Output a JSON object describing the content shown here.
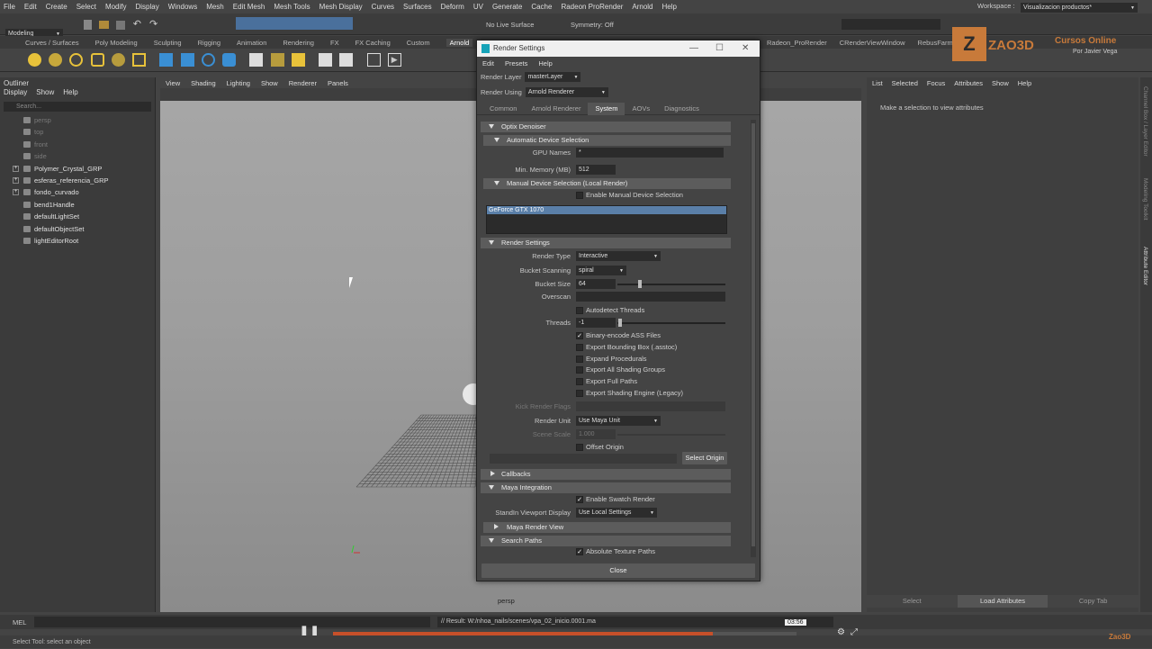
{
  "menubar": [
    "File",
    "Edit",
    "Create",
    "Select",
    "Modify",
    "Display",
    "Windows",
    "Mesh",
    "Edit Mesh",
    "Mesh Tools",
    "Mesh Display",
    "Curves",
    "Surfaces",
    "Deform",
    "UV",
    "Generate",
    "Cache",
    "Radeon ProRender",
    "Arnold",
    "Help"
  ],
  "workspace": {
    "label": "Workspace :",
    "value": "Visualizacion productos*"
  },
  "statusline": {
    "mode": "Modeling",
    "live": "No Live Surface",
    "symmetry": "Symmetry: Off"
  },
  "shelf_tabs": [
    "Curves / Surfaces",
    "Poly Modeling",
    "Sculpting",
    "Rigging",
    "Animation",
    "Rendering",
    "FX",
    "FX Caching",
    "Custom",
    "Arnold"
  ],
  "shelf_tabs_right": [
    "Radeon_ProRender",
    "CRenderViewWindow",
    "RebusFarm"
  ],
  "brand": {
    "logo": "ZAO3D",
    "title": "Cursos Online",
    "subtitle": "Por Javier Vega"
  },
  "outliner": {
    "title": "Outliner",
    "menu": [
      "Display",
      "Show",
      "Help"
    ],
    "search": "Search...",
    "items": [
      {
        "label": "persp",
        "dim": true,
        "type": "cam"
      },
      {
        "label": "top",
        "dim": true,
        "type": "cam"
      },
      {
        "label": "front",
        "dim": true,
        "type": "cam"
      },
      {
        "label": "side",
        "dim": true,
        "type": "cam"
      },
      {
        "label": "Polymer_Crystal_GRP",
        "dim": false,
        "type": "grp"
      },
      {
        "label": "esferas_referencia_GRP",
        "dim": false,
        "type": "grp"
      },
      {
        "label": "fondo_curvado",
        "dim": false,
        "type": "grp"
      },
      {
        "label": "bend1Handle",
        "dim": false,
        "type": "obj"
      },
      {
        "label": "defaultLightSet",
        "dim": false,
        "type": "obj"
      },
      {
        "label": "defaultObjectSet",
        "dim": false,
        "type": "obj"
      },
      {
        "label": "lightEditorRoot",
        "dim": false,
        "type": "obj"
      }
    ]
  },
  "viewport": {
    "menu": [
      "View",
      "Shading",
      "Lighting",
      "Show",
      "Renderer",
      "Panels"
    ],
    "camera": "persp"
  },
  "attribute_editor": {
    "menu": [
      "List",
      "Selected",
      "Focus",
      "Attributes",
      "Show",
      "Help"
    ],
    "message": "Make a selection to view attributes",
    "buttons": [
      "Select",
      "Load Attributes",
      "Copy Tab"
    ],
    "side_tabs": [
      "Channel Box / Layer Editor",
      "Modeling Toolkit",
      "Attribute Editor"
    ]
  },
  "dialog": {
    "title": "Render Settings",
    "menu": [
      "Edit",
      "Presets",
      "Help"
    ],
    "render_layer_label": "Render Layer",
    "render_layer": "masterLayer",
    "render_using_label": "Render Using",
    "render_using": "Arnold Renderer",
    "tabs": [
      "Common",
      "Arnold Renderer",
      "System",
      "AOVs",
      "Diagnostics"
    ],
    "sections": {
      "optix": "Optix Denoiser",
      "auto_device": "Automatic Device Selection",
      "gpu_names_label": "GPU Names",
      "gpu_names": "*",
      "min_memory_label": "Min. Memory (MB)",
      "min_memory": "512",
      "manual_device": "Manual Device Selection (Local Render)",
      "enable_manual": "Enable Manual Device Selection",
      "gpu_list_item": "GeForce GTX 1070",
      "render_settings": "Render Settings",
      "render_type_label": "Render Type",
      "render_type": "Interactive",
      "bucket_scanning_label": "Bucket Scanning",
      "bucket_scanning": "spiral",
      "bucket_size_label": "Bucket Size",
      "bucket_size": "64",
      "overscan_label": "Overscan",
      "autodetect": "Autodetect Threads",
      "threads_label": "Threads",
      "threads": "-1",
      "binary_encode": "Binary-encode ASS Files",
      "export_bbox": "Export Bounding Box (.asstoc)",
      "expand_proc": "Expand Procedurals",
      "export_shading": "Export All Shading Groups",
      "export_full": "Export Full Paths",
      "export_engine": "Export Shading Engine (Legacy)",
      "kick_label": "Kick Render Flags",
      "render_unit_label": "Render Unit",
      "render_unit": "Use Maya Unit",
      "scene_scale_label": "Scene Scale",
      "scene_scale": "1.000",
      "offset_origin": "Offset Origin",
      "select_origin": "Select Origin",
      "callbacks": "Callbacks",
      "maya_integration": "Maya Integration",
      "swatch": "Enable Swatch Render",
      "standin_label": "StandIn Viewport Display",
      "standin": "Use Local Settings",
      "maya_render_view": "Maya Render View",
      "search_paths": "Search Paths",
      "absolute_tex": "Absolute Texture Paths"
    },
    "close": "Close"
  },
  "command": {
    "lang": "MEL",
    "result": "// Result: W:/nhoa_nails/scenes/vpa_02_inicio.0001.ma"
  },
  "player": {
    "time": "03:56",
    "progress": 0.82
  },
  "helpline": "Select Tool: select an object",
  "watermark": "Zao3D"
}
